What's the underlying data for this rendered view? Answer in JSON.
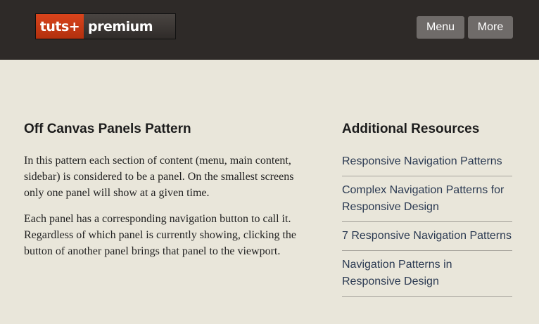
{
  "header": {
    "logo": {
      "part1": "tuts+",
      "part2": "premium"
    },
    "buttons": {
      "menu": "Menu",
      "more": "More"
    },
    "colors": {
      "bar": "#2e2a28",
      "logo_accent": "#d9441c",
      "button": "#6f6b69"
    }
  },
  "main": {
    "title": "Off Canvas Panels Pattern",
    "paragraphs": [
      "In this pattern each section of content (menu, main content, sidebar) is considered to be a panel. On the smallest screens only one panel will show at a given time.",
      "Each panel has a corresponding navigation button to call it. Regardless of which panel is currently showing, clicking the button of another panel brings that panel to the viewport."
    ]
  },
  "sidebar": {
    "title": "Additional Resources",
    "links": [
      "Responsive Navigation Patterns",
      "Complex Navigation Patterns for Responsive Design",
      "7 Responsive Navigation Patterns",
      "Navigation Patterns in Responsive Design"
    ]
  }
}
